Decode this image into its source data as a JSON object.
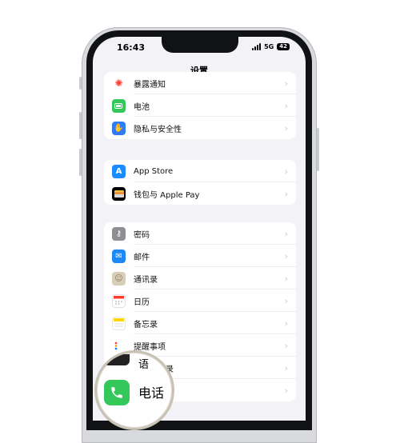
{
  "status_bar": {
    "time": "16:43",
    "network": "5G",
    "battery": "42"
  },
  "nav": {
    "title": "设置"
  },
  "groups": [
    {
      "rows": [
        {
          "label": "暴露通知",
          "icon": "exposure-icon",
          "color": "#ff3b30"
        },
        {
          "label": "电池",
          "icon": "battery-icon",
          "color": "#34c759"
        },
        {
          "label": "隐私与安全性",
          "icon": "hand-icon",
          "color": "#2f7cf6"
        }
      ]
    },
    {
      "rows": [
        {
          "label": "App Store",
          "icon": "app-store-icon",
          "color": "#1a8cff"
        },
        {
          "label": "钱包与 Apple Pay",
          "icon": "wallet-icon",
          "color": "#000000"
        }
      ]
    },
    {
      "rows": [
        {
          "label": "密码",
          "icon": "key-icon",
          "color": "#8e8e93"
        },
        {
          "label": "邮件",
          "icon": "mail-icon",
          "color": "#1e88f5"
        },
        {
          "label": "通讯录",
          "icon": "contacts-icon",
          "color": "#c9b89a"
        },
        {
          "label": "日历",
          "icon": "calendar-icon",
          "color": "#ffffff"
        },
        {
          "label": "备忘录",
          "icon": "notes-icon",
          "color": "#ffd60a"
        },
        {
          "label": "提醒事项",
          "icon": "reminders-icon",
          "color": "#ffffff"
        },
        {
          "label": "语音备忘录",
          "icon": "voice-memos-icon",
          "color": "#1c1c1e"
        },
        {
          "label": "电话",
          "icon": "phone-icon",
          "color": "#34c759"
        }
      ]
    }
  ],
  "magnifier": {
    "label": "电话",
    "ghost_label": "语"
  }
}
